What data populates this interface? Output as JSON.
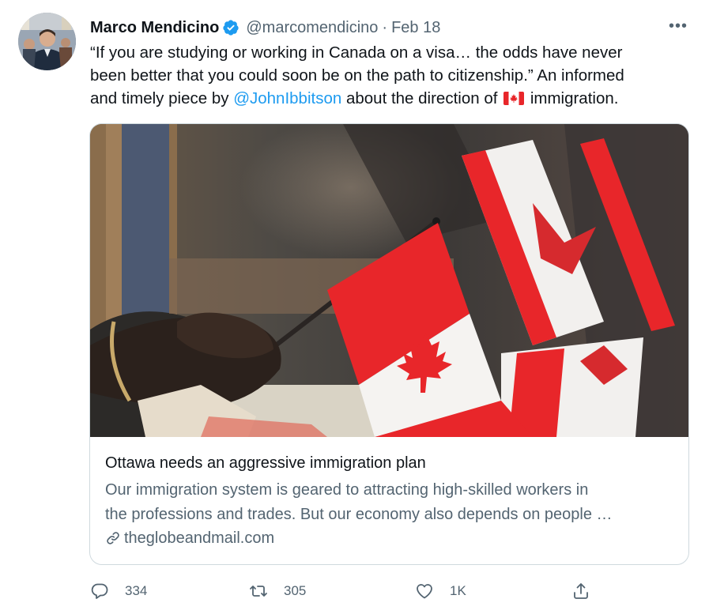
{
  "tweet": {
    "author_name": "Marco Mendicino",
    "handle": "@marcomendicino",
    "separator": "·",
    "date": "Feb 18",
    "more_label": "•••",
    "text": {
      "line1": "“If you are studying or working in Canada on a visa… the odds have never",
      "line2": "been better that you could soon be on the path to citizenship.” An informed",
      "line3_before": "and timely piece by ",
      "mention": "@JohnIbbitson",
      "line3_middle": " about the direction of ",
      "line3_after": " immigration."
    },
    "flag_emoji": "canada-flag-emoji"
  },
  "card": {
    "image_alt": "Hand holding a small Canadian flag at a citizenship ceremony",
    "title": "Ottawa needs an aggressive immigration plan",
    "desc_line1": "Our immigration system is geared to attracting high-skilled workers in",
    "desc_line2": "the professions and trades. But our economy also depends on people …",
    "domain": "theglobeandmail.com"
  },
  "actions": {
    "reply_count": "334",
    "retweet_count": "305",
    "like_count": "1K"
  },
  "colors": {
    "accent": "#1d9bf0",
    "secondary_text": "#536471",
    "border": "#cfd9de",
    "flag_red": "#e8262a"
  },
  "icons": [
    "verified-badge-icon",
    "more-icon",
    "link-icon",
    "reply-icon",
    "retweet-icon",
    "like-icon",
    "share-icon"
  ]
}
